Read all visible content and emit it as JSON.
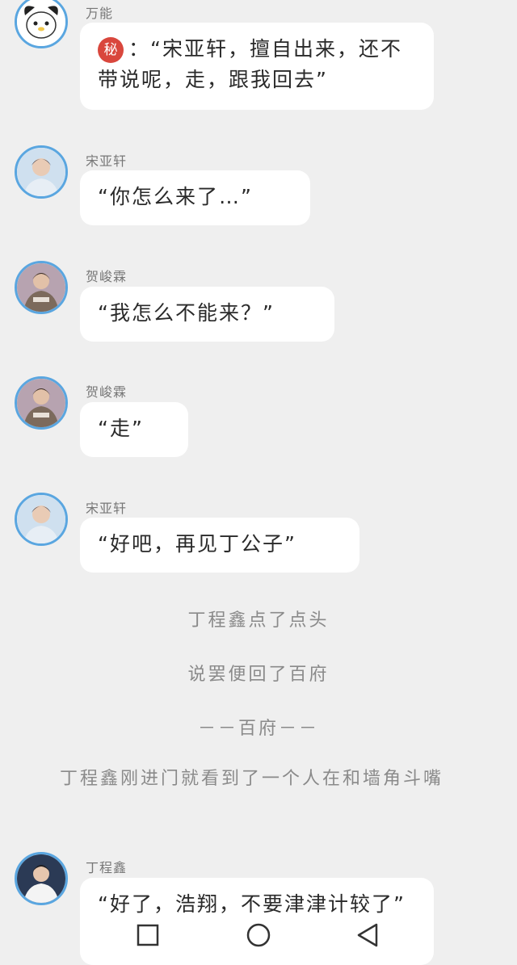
{
  "messages": [
    {
      "sender": "万能",
      "avatar_icon": "cartoon-dog-avatar-icon",
      "seal": "秘",
      "text": "：“宋亚轩，擅自出来，还不带说呢，走，跟我回去”"
    },
    {
      "sender": "宋亚轩",
      "avatar_icon": "boy-photo-avatar-icon",
      "text": "“你怎么来了…”"
    },
    {
      "sender": "贺峻霖",
      "avatar_icon": "boy-photo-avatar-icon",
      "text": "“我怎么不能来？”"
    },
    {
      "sender": "贺峻霖",
      "avatar_icon": "boy-photo-avatar-icon",
      "text": "“走”"
    },
    {
      "sender": "宋亚轩",
      "avatar_icon": "boy-photo-avatar-icon",
      "text": "“好吧，再见丁公子”"
    },
    {
      "sender": "丁程鑫",
      "avatar_icon": "boy-photo-avatar-icon",
      "text": "“好了，浩翔，不要津津计较了”"
    }
  ],
  "narration": [
    "丁程鑫点了点头",
    "说罢便回了百府",
    "－－百府－－",
    "丁程鑫刚进门就看到了一个人在和墙角斗嘴"
  ],
  "navbar": {
    "buttons": [
      "recent-apps",
      "home",
      "back"
    ]
  }
}
